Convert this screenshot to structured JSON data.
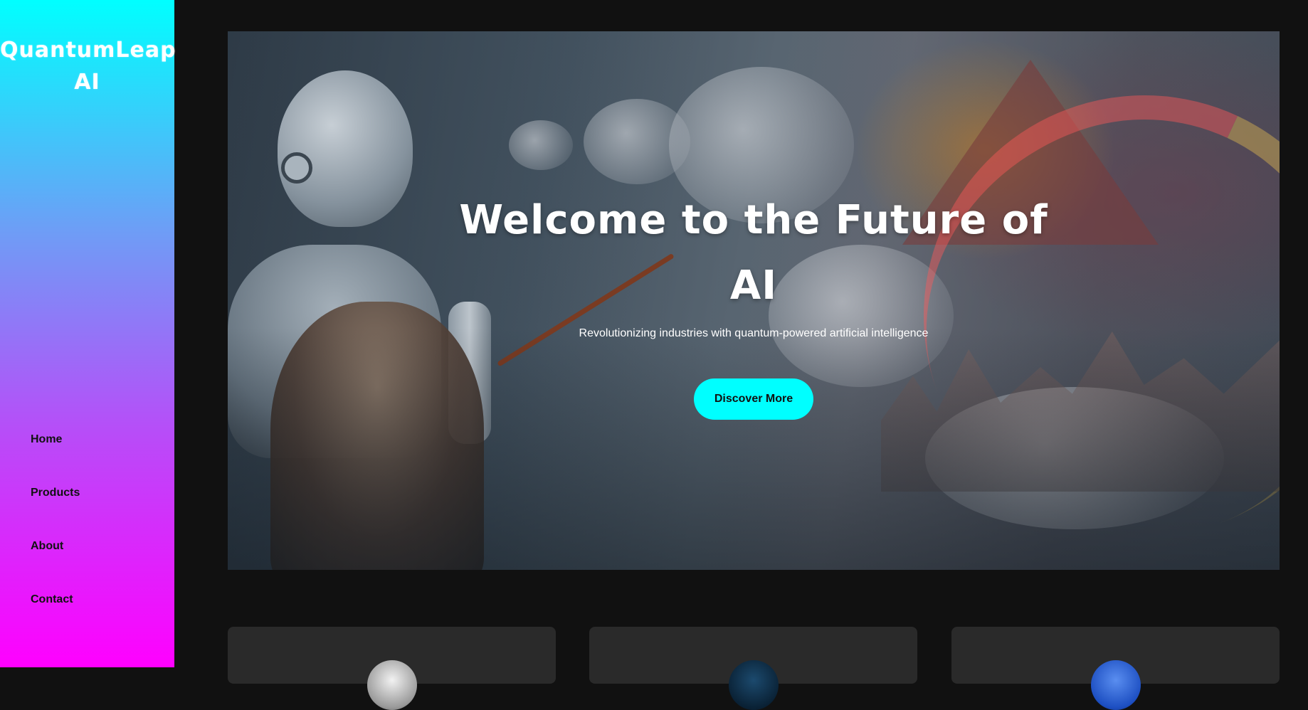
{
  "brand": {
    "name": "QuantumLeap AI"
  },
  "nav": {
    "items": [
      {
        "label": "Home"
      },
      {
        "label": "Products"
      },
      {
        "label": "About"
      },
      {
        "label": "Contact"
      }
    ]
  },
  "hero": {
    "title": "Welcome to the Future of AI",
    "subtitle": "Revolutionizing industries with quantum-powered artificial intelligence",
    "cta_label": "Discover More"
  },
  "colors": {
    "accent": "#00ffff",
    "sidebar_gradient_top": "#00ffff",
    "sidebar_gradient_bottom": "#ff00ff",
    "background": "#111111",
    "card_background": "#2a2a2a"
  },
  "cards": [
    {
      "avatar": "avatar-image"
    },
    {
      "avatar": "avatar-image"
    },
    {
      "avatar": "avatar-image"
    }
  ]
}
